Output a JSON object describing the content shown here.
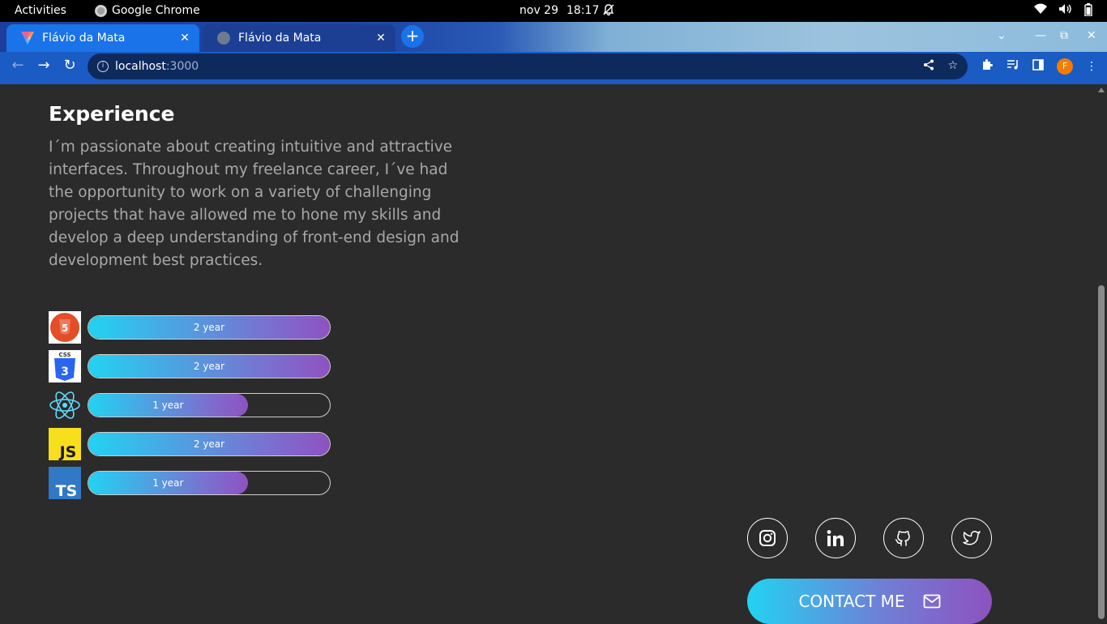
{
  "os_bar": {
    "activities": "Activities",
    "app_name": "Google Chrome",
    "date": "nov 29",
    "time": "18:17"
  },
  "browser": {
    "tabs": [
      {
        "title": "Flávio da Mata",
        "active": true
      },
      {
        "title": "Flávio da Mata",
        "active": false
      }
    ],
    "new_tab": "+",
    "url_host": "localhost",
    "url_port": ":3000",
    "profile_initial": "F"
  },
  "experience": {
    "title": "Experience",
    "text": "I´m passionate about creating intuitive and attractive interfaces. Throughout my freelance career, I´ve had the opportunity to work on a variety of challenging projects that have allowed me to hone my skills and develop a deep understanding of front-end design and development best practices."
  },
  "skills": [
    {
      "name": "html5-icon",
      "label": "2 year",
      "level": 1.0
    },
    {
      "name": "css3-icon",
      "label": "2 year",
      "level": 1.0
    },
    {
      "name": "react-icon",
      "label": "1 year",
      "level": 0.66
    },
    {
      "name": "javascript-icon",
      "label": "2 year",
      "level": 1.0
    },
    {
      "name": "typescript-icon",
      "label": "1 year",
      "level": 0.66
    }
  ],
  "logos": {
    "css": "CSS",
    "js": "JS",
    "ts": "TS"
  },
  "social": [
    "instagram-icon",
    "linkedin-icon",
    "github-icon",
    "twitter-icon"
  ],
  "contact": {
    "label": "CONTACT ME"
  },
  "colors": {
    "background": "#2b2b2b",
    "gradient_start": "#22d3f2",
    "gradient_end": "#8e52c0",
    "browser_accent": "#1a73e8"
  }
}
